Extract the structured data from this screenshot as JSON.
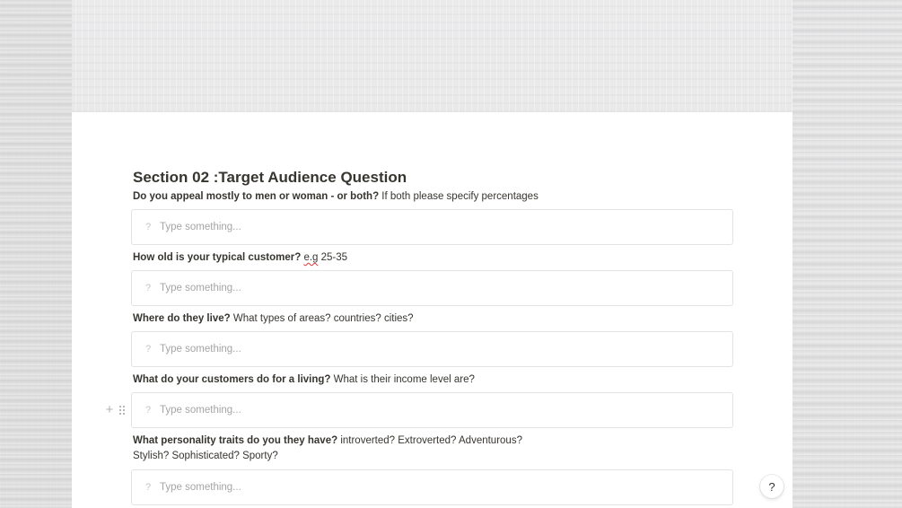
{
  "section": {
    "title": "Section 02 :Target Audience Question"
  },
  "questions": [
    {
      "bold": "Do you appeal mostly to men or woman - or both?",
      "hint": " If both please specify percentages",
      "answer_placeholder": "Type something..."
    },
    {
      "bold": "How old is your typical customer?",
      "hint_prefix": " ",
      "hint_underlined": "e.g",
      "hint": " 25-35",
      "answer_placeholder": "Type something..."
    },
    {
      "bold": "Where do they live?",
      "hint": " What types of areas? countries? cities?",
      "answer_placeholder": "Type something..."
    },
    {
      "bold": "What do your customers do for a living?",
      "hint": " What is their income level are?",
      "answer_placeholder": "Type something..."
    },
    {
      "bold": "What personality traits do you they have?",
      "hint": " introverted? Extroverted? Adventurous?",
      "hint_line2": "Stylish? Sophisticated? Sporty?",
      "answer_placeholder": "Type something..."
    }
  ],
  "icons": {
    "answer_prefix": "?",
    "add_block": "+",
    "help": "?"
  }
}
